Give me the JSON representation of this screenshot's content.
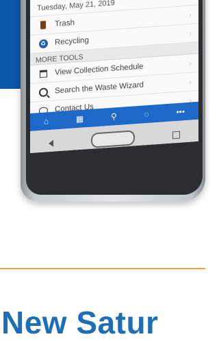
{
  "app": {
    "date": "Tuesday, May 21, 2019",
    "items": [
      {
        "label": "Trash",
        "icon": "trash-icon"
      },
      {
        "label": "Recycling",
        "icon": "recycle-icon"
      }
    ],
    "more_tools_header": "MORE TOOLS",
    "tools": [
      {
        "label": "View Collection Schedule",
        "icon": "calendar-icon"
      },
      {
        "label": "Search the Waste Wizard",
        "icon": "search-icon"
      },
      {
        "label": "Contact Us",
        "icon": "chat-icon"
      }
    ],
    "tabbar": [
      {
        "glyph": "⌂",
        "icon": "home-icon"
      },
      {
        "glyph": "▦",
        "icon": "calendar-icon"
      },
      {
        "glyph": "⚲",
        "icon": "search-icon"
      },
      {
        "glyph": "◌",
        "icon": "chat-icon"
      },
      {
        "glyph": "•••",
        "icon": "more-icon"
      }
    ]
  },
  "headline": "New Satur",
  "colors": {
    "brand_blue": "#1d68c9",
    "accent_orange": "#f0a63a"
  }
}
